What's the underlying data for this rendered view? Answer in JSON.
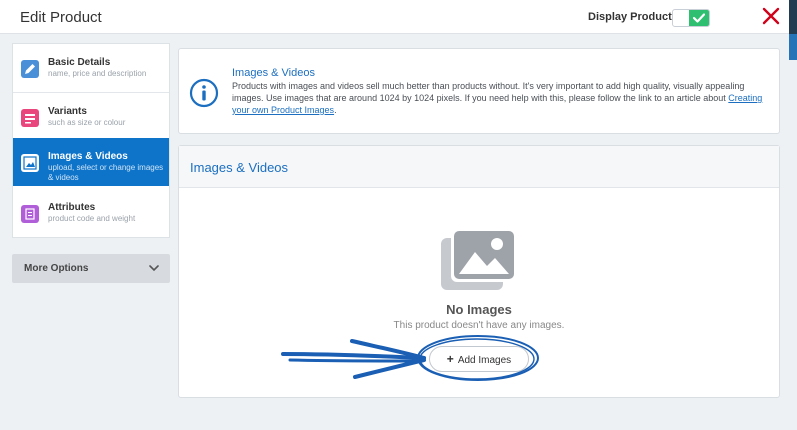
{
  "modal": {
    "title": "Edit Product",
    "display_toggle": {
      "label": "Display Product",
      "on": true
    }
  },
  "sidebar": {
    "items": [
      {
        "label": "Basic Details",
        "sub": "name, price and description",
        "icon": "pencil-icon",
        "active": false
      },
      {
        "label": "Variants",
        "sub": "such as size or colour",
        "icon": "variants-icon",
        "active": false
      },
      {
        "label": "Images & Videos",
        "sub": "upload, select or change images & videos",
        "icon": "image-file-icon",
        "active": true
      },
      {
        "label": "Attributes",
        "sub": "product code and weight",
        "icon": "attributes-icon",
        "active": false
      }
    ],
    "more_options": "More Options"
  },
  "info": {
    "title": "Images & Videos",
    "text": "Products with images and videos sell much better than products without. It's very important to add high quality, visually appealing images. Use images that are around 1024 by 1024 pixels. If you need help with this, please follow the link to an article about ",
    "link": "Creating your own Product Images",
    "tail": "."
  },
  "images": {
    "title": "Images & Videos",
    "empty_title": "No Images",
    "empty_text": "This product doesn't have any images.",
    "add_button": "Add Images"
  },
  "colors": {
    "accent": "#0e74c9",
    "toggle_on": "#2fbf71",
    "close": "#d0021b",
    "annotation": "#1a5fb4"
  }
}
